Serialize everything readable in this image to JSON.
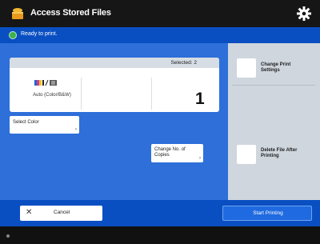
{
  "header": {
    "title": "Access Stored Files",
    "icon": "storage-box-icon",
    "settings_icon": "gear-icon"
  },
  "status": {
    "text": "Ready to print.",
    "color": "#3cb24a"
  },
  "print_panel": {
    "selected_text": "Selected: 2",
    "color_mode_label": "Auto (Color/B&W)",
    "copies": "1"
  },
  "buttons": {
    "select_color": "Select Color",
    "change_copies": "Change No. of Copies",
    "change_print_settings": "Change Print Settings",
    "delete_after_printing": "Delete File After Printing",
    "cancel": "Cancel",
    "start_printing": "Start Printing"
  },
  "colors": {
    "accent": "#0a4fc2",
    "main_bg": "#2e6fd9",
    "side_panel": "#cfd6de"
  }
}
